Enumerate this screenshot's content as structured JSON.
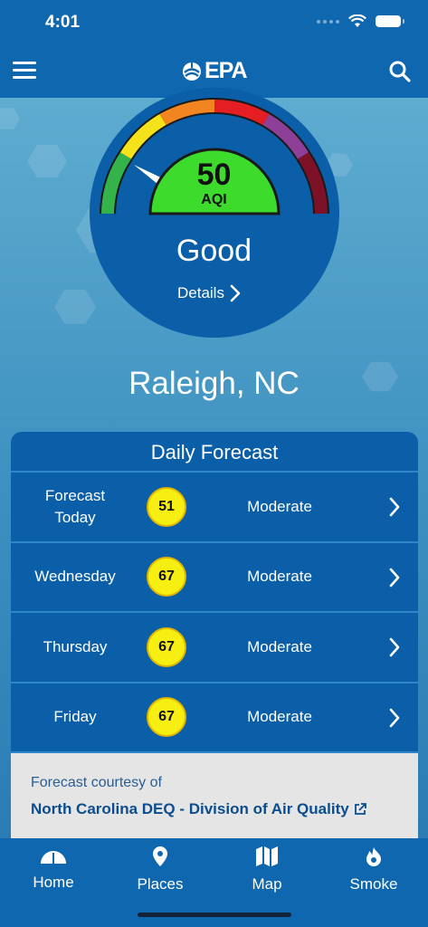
{
  "status_bar": {
    "time": "4:01"
  },
  "header": {
    "logo_text": "EPA"
  },
  "gauge": {
    "aqi": "50",
    "aqi_label": "AQI",
    "category": "Good",
    "details_label": "Details"
  },
  "location": {
    "city": "Raleigh, NC"
  },
  "forecast": {
    "title": "Daily Forecast",
    "rows": [
      {
        "day": "Forecast Today",
        "aqi": "51",
        "level": "Moderate"
      },
      {
        "day": "Wednesday",
        "aqi": "67",
        "level": "Moderate"
      },
      {
        "day": "Thursday",
        "aqi": "67",
        "level": "Moderate"
      },
      {
        "day": "Friday",
        "aqi": "67",
        "level": "Moderate"
      }
    ],
    "courtesy_label": "Forecast courtesy of",
    "courtesy_link": "North Carolina DEQ - Division of Air Quality"
  },
  "tabs": [
    {
      "label": "Home",
      "icon": "gauge-icon"
    },
    {
      "label": "Places",
      "icon": "location-pin-icon"
    },
    {
      "label": "Map",
      "icon": "map-icon"
    },
    {
      "label": "Smoke",
      "icon": "flame-icon"
    }
  ],
  "colors": {
    "header_bg": "#0f67b0",
    "good": "#33cc33",
    "moderate": "#f7ee12",
    "card_bg": "#0b5ea8"
  }
}
